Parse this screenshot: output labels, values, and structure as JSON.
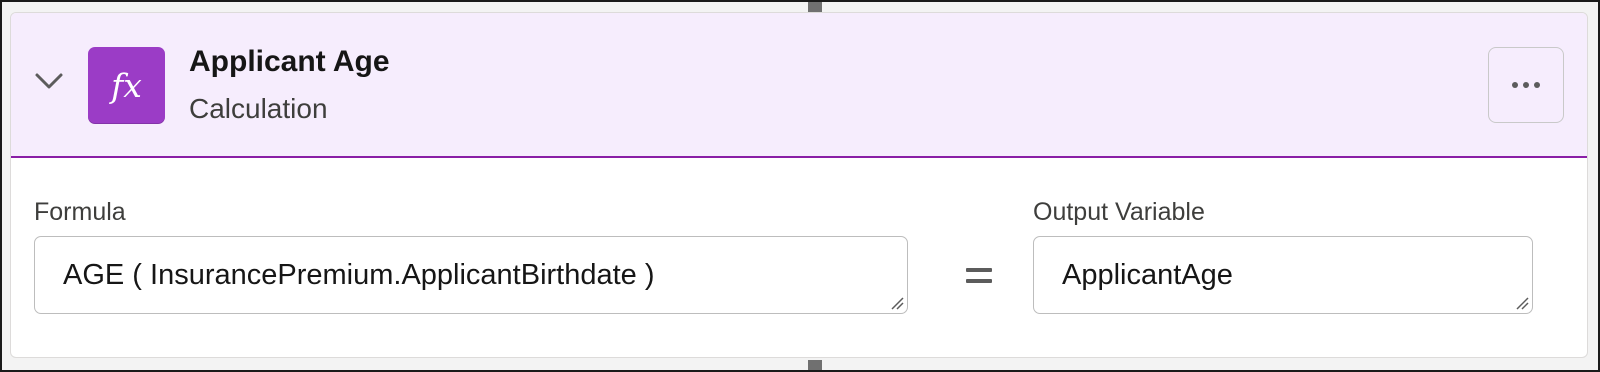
{
  "element": {
    "title": "Applicant Age",
    "type": "Calculation",
    "icon": "formula-fx-icon",
    "icon_glyph": "fx",
    "accent_color": "#9b3cc6",
    "header_background": "#f6edfd"
  },
  "formula": {
    "label": "Formula",
    "value": "AGE ( InsurancePremium.ApplicantBirthdate )"
  },
  "operator": "=",
  "output": {
    "label": "Output Variable",
    "value": "ApplicantAge"
  },
  "menu": {
    "icon": "more-actions-icon"
  }
}
